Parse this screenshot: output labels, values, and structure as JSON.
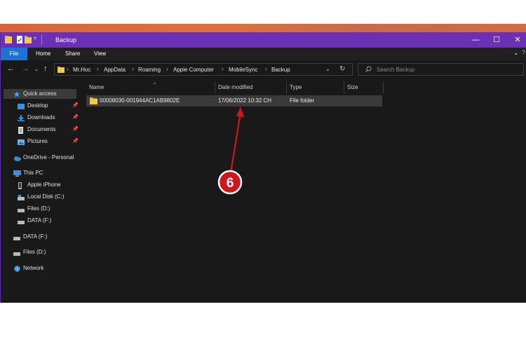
{
  "window": {
    "title": "Backup"
  },
  "window_controls": {
    "minimize": "—",
    "maximize": "☐",
    "close": "✕"
  },
  "ribbon": {
    "tabs": [
      "File",
      "Home",
      "Share",
      "View"
    ]
  },
  "address": {
    "crumbs": [
      "Mr.Hoc",
      "AppData",
      "Roaming",
      "Apple Computer",
      "MobileSync",
      "Backup"
    ]
  },
  "search": {
    "placeholder": "Search Backup"
  },
  "sidebar": {
    "items": [
      {
        "label": "Quick access",
        "icon": "star-icon",
        "pinned": false
      },
      {
        "label": "Desktop",
        "icon": "desktop-icon",
        "pinned": true
      },
      {
        "label": "Downloads",
        "icon": "download-icon",
        "pinned": true
      },
      {
        "label": "Documents",
        "icon": "document-icon",
        "pinned": true
      },
      {
        "label": "Pictures",
        "icon": "picture-icon",
        "pinned": true
      },
      {
        "label": "OneDrive - Personal",
        "icon": "cloud-icon",
        "pinned": false
      },
      {
        "label": "This PC",
        "icon": "pc-icon",
        "pinned": false
      },
      {
        "label": "Apple iPhone",
        "icon": "phone-icon",
        "pinned": false
      },
      {
        "label": "Local Disk (C:)",
        "icon": "disk-icon",
        "pinned": false
      },
      {
        "label": "Files (D:)",
        "icon": "drive-icon",
        "pinned": false
      },
      {
        "label": "DATA (F:)",
        "icon": "drive-icon",
        "pinned": false
      },
      {
        "label": "DATA (F:)",
        "icon": "drive-icon",
        "pinned": false
      },
      {
        "label": "Files (D:)",
        "icon": "drive-icon",
        "pinned": false
      },
      {
        "label": "Network",
        "icon": "network-icon",
        "pinned": false
      }
    ]
  },
  "columns": {
    "name": "Name",
    "date": "Date modified",
    "type": "Type",
    "size": "Size"
  },
  "files": [
    {
      "name": "00008030-001944AC1AB9802E",
      "date": "17/06/2022 10:32 CH",
      "type": "File folder",
      "size": ""
    }
  ],
  "annotation": {
    "label": "6",
    "color": "#d0161b"
  },
  "colors": {
    "titlebar": "#6b30b5",
    "file_tab": "#1a73d9",
    "folder": "#f2c94c",
    "window_bg": "#191919"
  }
}
